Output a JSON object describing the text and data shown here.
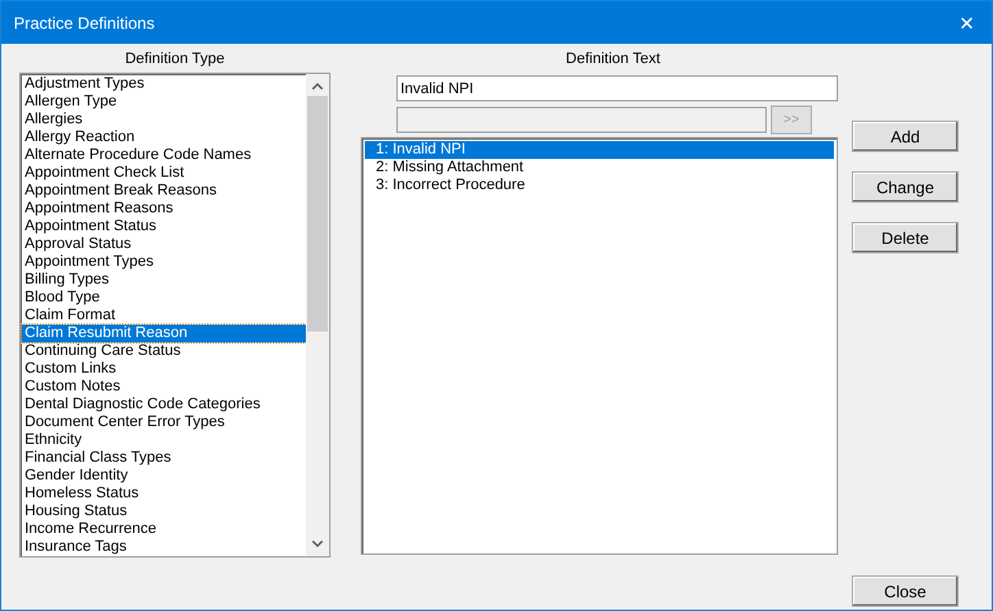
{
  "window": {
    "title": "Practice Definitions",
    "close": "✕"
  },
  "definition_type": {
    "label": "Definition Type",
    "items": [
      {
        "label": "Adjustment Types",
        "selected": false
      },
      {
        "label": "Allergen Type",
        "selected": false
      },
      {
        "label": "Allergies",
        "selected": false
      },
      {
        "label": "Allergy Reaction",
        "selected": false
      },
      {
        "label": "Alternate Procedure Code Names",
        "selected": false
      },
      {
        "label": "Appointment Check List",
        "selected": false
      },
      {
        "label": "Appointment Break Reasons",
        "selected": false
      },
      {
        "label": "Appointment Reasons",
        "selected": false
      },
      {
        "label": "Appointment Status",
        "selected": false
      },
      {
        "label": "Approval Status",
        "selected": false
      },
      {
        "label": "Appointment Types",
        "selected": false
      },
      {
        "label": "Billing Types",
        "selected": false
      },
      {
        "label": "Blood Type",
        "selected": false
      },
      {
        "label": "Claim Format",
        "selected": false
      },
      {
        "label": "Claim Resubmit Reason",
        "selected": true
      },
      {
        "label": "Continuing Care Status",
        "selected": false
      },
      {
        "label": "Custom Links",
        "selected": false
      },
      {
        "label": "Custom Notes",
        "selected": false
      },
      {
        "label": "Dental Diagnostic Code Categories",
        "selected": false
      },
      {
        "label": "Document Center Error Types",
        "selected": false
      },
      {
        "label": "Ethnicity",
        "selected": false
      },
      {
        "label": "Financial Class Types",
        "selected": false
      },
      {
        "label": "Gender Identity",
        "selected": false
      },
      {
        "label": "Homeless Status",
        "selected": false
      },
      {
        "label": "Housing Status",
        "selected": false
      },
      {
        "label": "Income Recurrence",
        "selected": false
      },
      {
        "label": "Insurance Tags",
        "selected": false
      }
    ]
  },
  "definition_text": {
    "label": "Definition Text",
    "value": "Invalid NPI",
    "secondary_disabled": true,
    "transfer_button": ">>",
    "items": [
      {
        "label": "1: Invalid NPI",
        "selected": true
      },
      {
        "label": "2: Missing Attachment",
        "selected": false
      },
      {
        "label": "3: Incorrect Procedure",
        "selected": false
      }
    ]
  },
  "buttons": [
    "Add",
    "Change",
    "Delete"
  ],
  "close_button": "Close"
}
